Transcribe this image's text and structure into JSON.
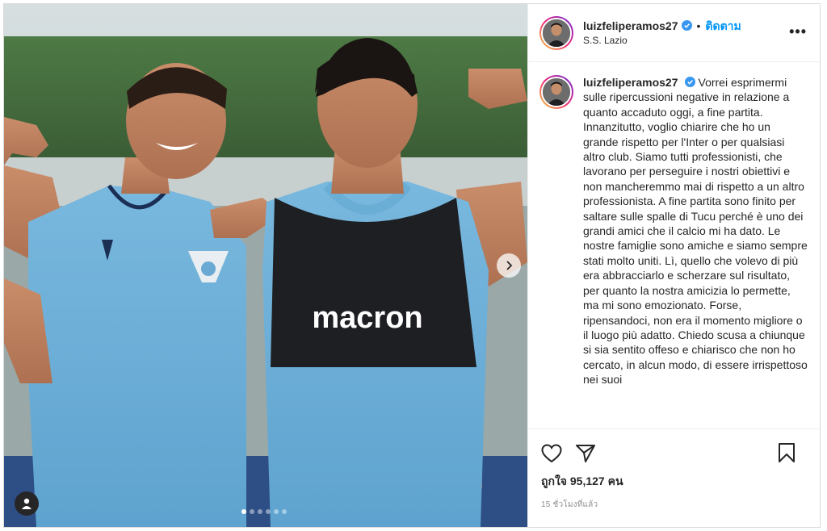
{
  "header": {
    "username": "luizfeliperamos27",
    "follow_label": "ติดตาม",
    "location": "S.S. Lazio",
    "more_icon": "more-options-icon"
  },
  "photo": {
    "jersey_brand_text": "macron",
    "carousel": {
      "total": 6,
      "active_index": 0
    }
  },
  "caption": {
    "username": "luizfeliperamos27",
    "text": "Vorrei esprimermi sulle ripercussioni negative in relazione a quanto accaduto oggi, a fine partita. Innanzitutto, voglio chiarire che ho un grande rispetto per l'Inter o per qualsiasi altro club. Siamo tutti professionisti, che lavorano per perseguire i nostri obiettivi e non mancheremmo mai di rispetto a un altro professionista. A fine partita sono finito per saltare sulle spalle di Tucu perché è uno dei grandi amici che il calcio mi ha dato. Le nostre famiglie sono amiche e siamo sempre stati molto uniti. Lì, quello che volevo di più era abbracciarlo e scherzare sul risultato, per quanto la nostra amicizia lo permette, ma mi sono emozionato. Forse, ripensandoci, non era il momento migliore o il luogo più adatto. Chiedo scusa a chiunque si sia sentito offeso e chiarisco che non ho cercato, in alcun modo, di essere irrispettoso nei suoi"
  },
  "actions": {
    "icons": [
      "heart-icon",
      "share-icon",
      "bookmark-icon"
    ],
    "likes_text": "ถูกใจ 95,127 คน",
    "timestamp": "15 ชั่วโมงที่แล้ว"
  },
  "colors": {
    "link_blue": "#0095f6",
    "verified_blue": "#3897f0",
    "jersey_light_blue": "#6aaed6",
    "bib_black": "#1e1f22"
  }
}
